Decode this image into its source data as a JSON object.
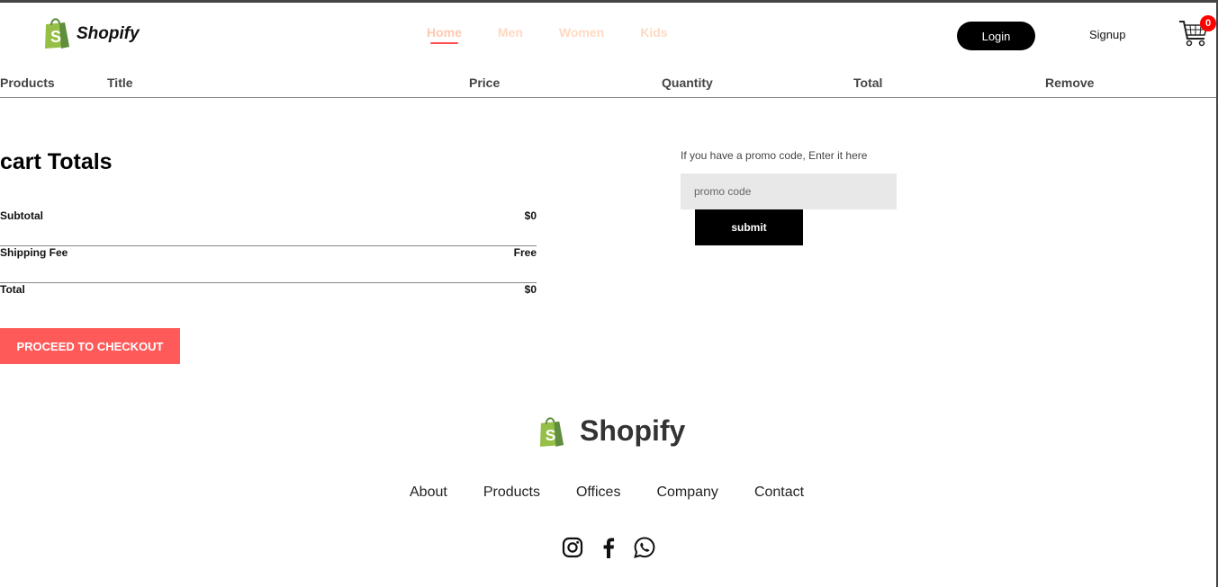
{
  "header": {
    "brand": "Shopify",
    "nav": [
      "Home",
      "Men",
      "Women",
      "Kids"
    ],
    "active_nav": "Home",
    "login_label": "Login",
    "signup_label": "Signup",
    "cart_count": "0"
  },
  "table": {
    "columns": [
      "Products",
      "Title",
      "Price",
      "Quantity",
      "Total",
      "Remove"
    ]
  },
  "totals": {
    "title": "cart Totals",
    "subtotal_label": "Subtotal",
    "subtotal_value": "$0",
    "shipping_label": "Shipping Fee",
    "shipping_value": "Free",
    "total_label": "Total",
    "total_value": "$0",
    "checkout_label": "PROCEED TO CHECKOUT"
  },
  "promo": {
    "label": "If you have a promo code, Enter it here",
    "placeholder": "promo code",
    "submit_label": "submit"
  },
  "footer": {
    "brand": "Shopify",
    "links": [
      "About",
      "Products",
      "Offices",
      "Company",
      "Contact"
    ],
    "socials": [
      "instagram-icon",
      "facebook-icon",
      "whatsapp-icon"
    ]
  },
  "colors": {
    "accent": "#ff5a5a",
    "nav_inactive": "#ffd9c2",
    "badge": "#ff0000",
    "brand_green": "#5e8e3e"
  }
}
